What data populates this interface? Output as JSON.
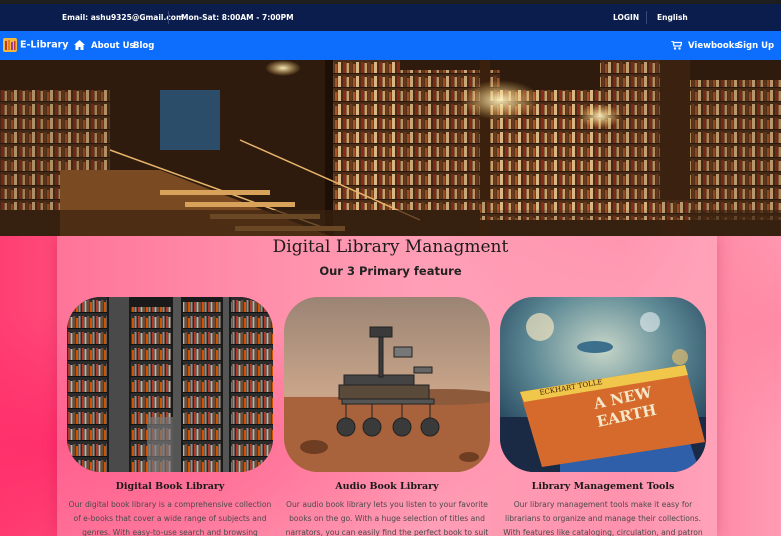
{
  "topbar": {
    "email": "Email: ashu9325@Gmail.com",
    "hours": "Mon-Sat: 8:00AM - 7:00PM",
    "login": "LOGIN",
    "language": "English"
  },
  "navbar": {
    "brand": "E-Library",
    "links": [
      "About Us",
      "Blog"
    ],
    "viewbooks": "Viewbooks",
    "signup": "Sign Up"
  },
  "hero": {
    "slide_count": 4,
    "active_slide": 3
  },
  "features": {
    "title": "Digital Library Managment",
    "subtitle": "Our 3 Primary feature",
    "cards": [
      {
        "title": "Digital Book Library",
        "text": "Our digital book library is a comprehensive collection of e-books that cover a wide range of subjects and genres. With easy-to-use search and browsing"
      },
      {
        "title": "Audio Book Library",
        "text": "Our audio book library lets you listen to your favorite books on the go. With a huge selection of titles and narrators, you can easily find the perfect book to suit"
      },
      {
        "title": "Library Management Tools",
        "text": "Our library management tools make it easy for librarians to organize and manage their collections. With features like cataloging, circulation, and patron"
      }
    ],
    "book_cover": {
      "title_line1": "A NEW",
      "title_line2": "EARTH",
      "author": "ECKHART TOLLE"
    }
  },
  "colors": {
    "topbar_bg": "#0b1d4d",
    "navbar_bg": "#0d6efd",
    "section_pink": "#ff6b8f"
  }
}
